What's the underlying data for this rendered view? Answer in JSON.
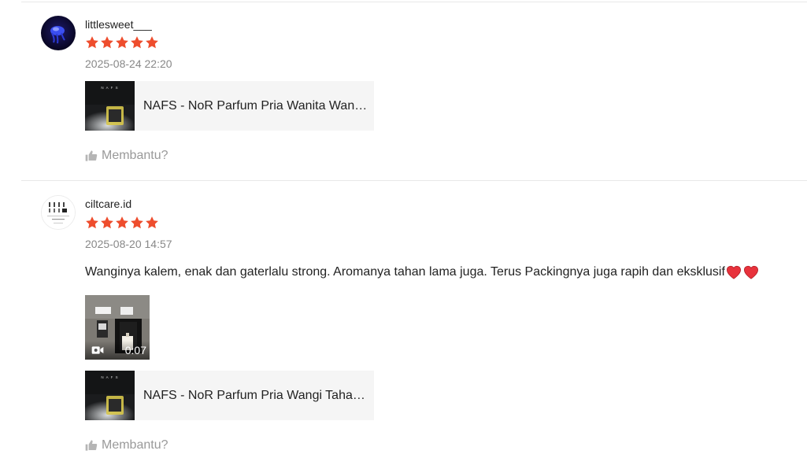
{
  "colors": {
    "star": "#ee4d2d",
    "divider": "#e8e8e8",
    "muted": "#888888",
    "chip_bg": "#f5f5f5",
    "heart": "#e8323c"
  },
  "reviews": [
    {
      "username": "littlesweet___",
      "rating": 5,
      "date": "2025-08-24 22:20",
      "avatar_icon": "blue-jellyfish-avatar",
      "product": {
        "name": "NAFS - NoR Parfum Pria Wanita Wangi Tahan Lama Unisex"
      },
      "helpful_label": "Membantu?",
      "helpful_icon": "thumbs-up-icon"
    },
    {
      "username": "ciltcare.id",
      "rating": 5,
      "date": "2025-08-20 14:57",
      "avatar_icon": "ciltcare-logo-avatar",
      "comment": "Wanginya kalem, enak dan gaterlalu strong. Aromanya tahan lama juga. Terus Packingnya juga rapih dan eksklusif",
      "comment_emojis": [
        "heart-emoji",
        "heart-emoji"
      ],
      "video": {
        "duration": "0:07",
        "icon": "video-camera-icon"
      },
      "product": {
        "name": "NAFS - NoR Parfum Pria Wangi Tahan Lama Unisex"
      },
      "helpful_label": "Membantu?",
      "helpful_icon": "thumbs-up-icon"
    }
  ]
}
